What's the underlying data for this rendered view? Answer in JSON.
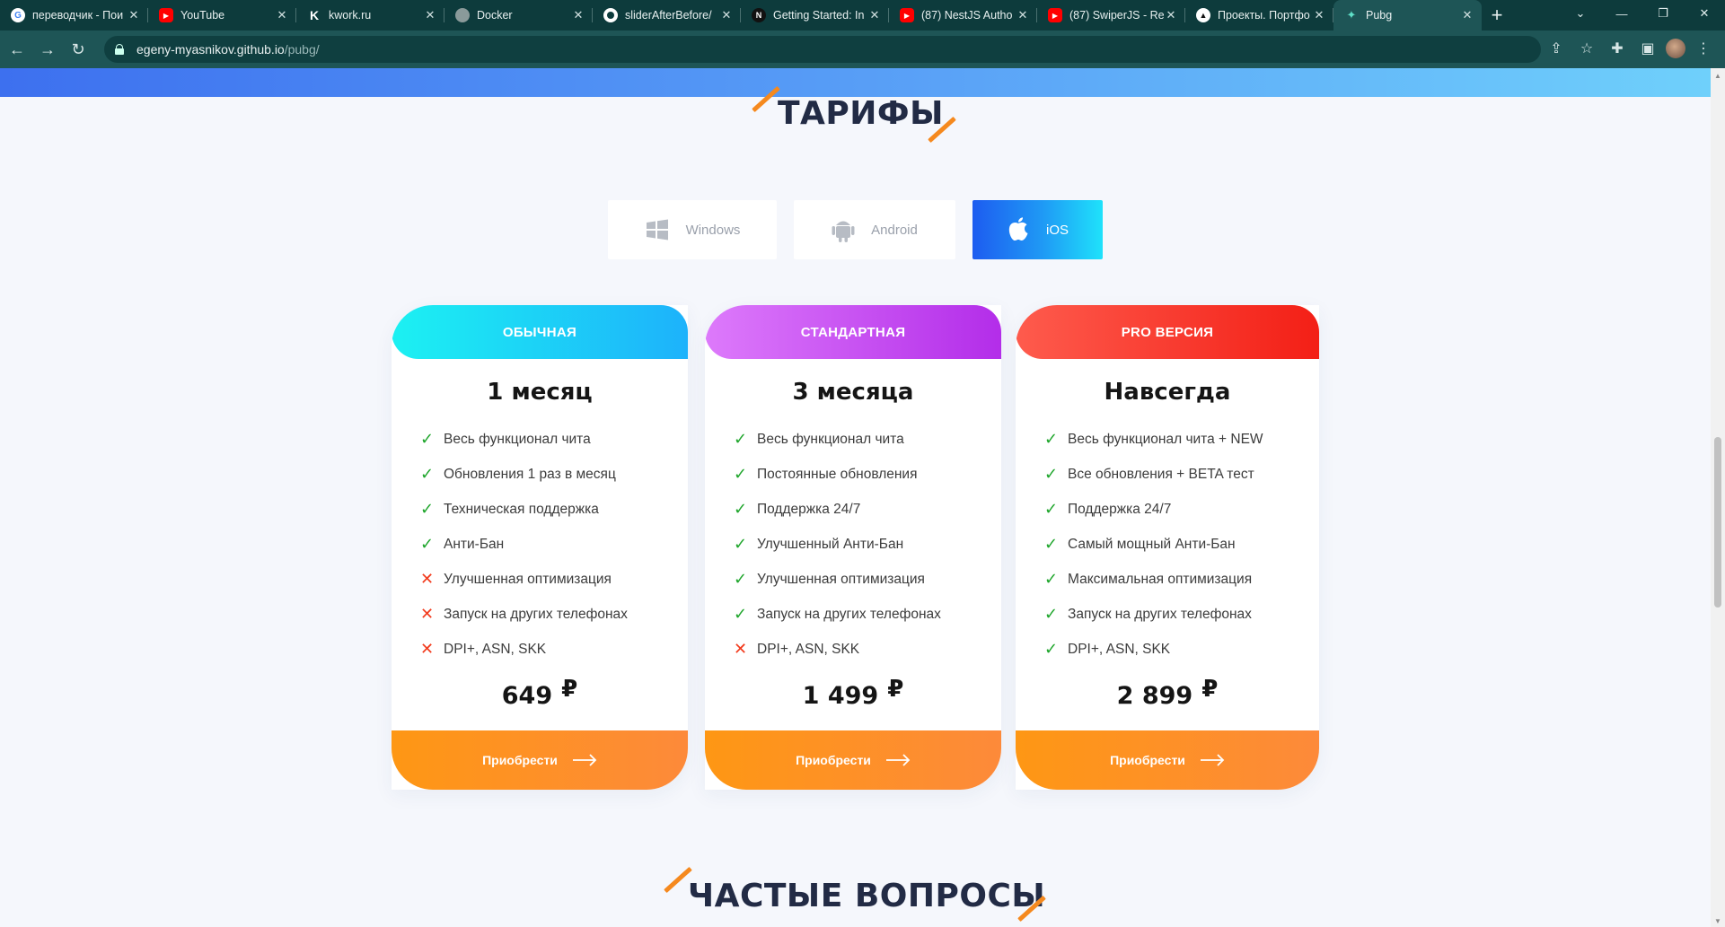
{
  "browser": {
    "tabs": [
      {
        "title": "переводчик - Пои",
        "color": "#ffffff",
        "glyph": "G",
        "icon": "google-icon"
      },
      {
        "title": "YouTube",
        "color": "#ff0000",
        "glyph": "▶",
        "icon": "youtube-icon"
      },
      {
        "title": "kwork.ru",
        "color": "#0d3b3c",
        "glyph": "K",
        "icon": "kwork-icon"
      },
      {
        "title": "Docker",
        "color": "#8a9a9a",
        "glyph": "",
        "icon": "globe-icon"
      },
      {
        "title": "sliderAfterBefore/",
        "color": "#ffffff",
        "glyph": "",
        "icon": "github-icon"
      },
      {
        "title": "Getting Started: In",
        "color": "#111111",
        "glyph": "N",
        "icon": "nextjs-icon"
      },
      {
        "title": "(87) NestJS Autho",
        "color": "#ff0000",
        "glyph": "▶",
        "icon": "youtube-icon"
      },
      {
        "title": "(87) SwiperJS - Re",
        "color": "#ff0000",
        "glyph": "▶",
        "icon": "youtube-icon"
      },
      {
        "title": "Проекты. Портфо",
        "color": "#111111",
        "glyph": "▲",
        "icon": "vercel-icon"
      },
      {
        "title": "Pubg",
        "color": "#1e5556",
        "glyph": "✦",
        "icon": "pubg-favicon-icon"
      }
    ],
    "url_host": "egeny-myasnikov.github.io",
    "url_path": "/pubg/"
  },
  "page": {
    "tariffs_title": "ТАРИФЫ",
    "faq_title": "ЧАСТЫЕ ВОПРОСЫ",
    "platforms": [
      {
        "label": "Windows",
        "icon": "windows-icon",
        "active": false
      },
      {
        "label": "Android",
        "icon": "android-icon",
        "active": false
      },
      {
        "label": "iOS",
        "icon": "apple-icon",
        "active": true
      }
    ],
    "plans": [
      {
        "name": "ОБЫЧНАЯ",
        "period": "1 месяц",
        "price": "649",
        "currency": "₽",
        "buy_label": "Приобрести",
        "features": [
          {
            "text": "Весь функционал чита",
            "included": true
          },
          {
            "text": "Обновления 1 раз в месяц",
            "included": true
          },
          {
            "text": "Техническая поддержка",
            "included": true
          },
          {
            "text": "Анти-Бан",
            "included": true
          },
          {
            "text": "Улучшенная оптимизация",
            "included": false
          },
          {
            "text": "Запуск на других телефонах",
            "included": false
          },
          {
            "text": "DPI+, ASN, SKK",
            "included": false
          }
        ]
      },
      {
        "name": "СТАНДАРТНАЯ",
        "period": "3 месяца",
        "price": "1 499",
        "currency": "₽",
        "buy_label": "Приобрести",
        "features": [
          {
            "text": "Весь функционал чита",
            "included": true
          },
          {
            "text": "Постоянные обновления",
            "included": true
          },
          {
            "text": "Поддержка 24/7",
            "included": true
          },
          {
            "text": "Улучшенный Анти-Бан",
            "included": true
          },
          {
            "text": "Улучшенная оптимизация",
            "included": true
          },
          {
            "text": "Запуск на других телефонах",
            "included": true
          },
          {
            "text": "DPI+, ASN, SKK",
            "included": false
          }
        ]
      },
      {
        "name": "PRO ВЕРСИЯ",
        "period": "Навсегда",
        "price": "2 899",
        "currency": "₽",
        "buy_label": "Приобрести",
        "features": [
          {
            "text": "Весь функционал чита + NEW",
            "included": true
          },
          {
            "text": "Все обновления + BETA тест",
            "included": true
          },
          {
            "text": "Поддержка 24/7",
            "included": true
          },
          {
            "text": "Самый мощный Анти-Бан",
            "included": true
          },
          {
            "text": "Максимальная оптимизация",
            "included": true
          },
          {
            "text": "Запуск на других телефонах",
            "included": true
          },
          {
            "text": "DPI+, ASN, SKK",
            "included": true
          }
        ]
      }
    ]
  }
}
